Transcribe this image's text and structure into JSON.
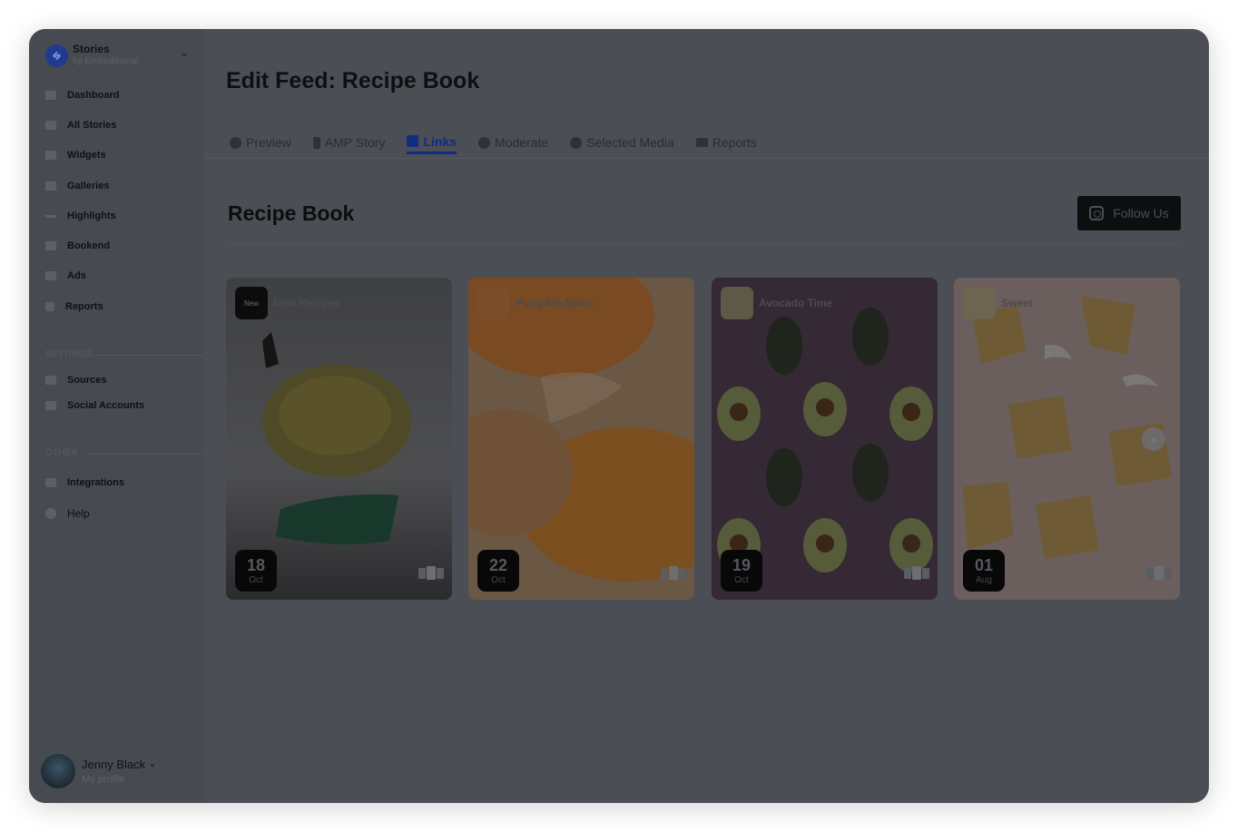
{
  "brand": {
    "name": "Stories",
    "sub": "by EmbedSocial",
    "logo_icon": "embedsocial-logo-icon"
  },
  "sidebar": {
    "items": [
      {
        "label": "Dashboard",
        "icon": "chart-icon"
      },
      {
        "label": "All Stories",
        "icon": "stories-icon"
      },
      {
        "label": "Widgets",
        "icon": "widgets-icon"
      },
      {
        "label": "Galleries",
        "icon": "galleries-icon"
      },
      {
        "label": "Highlights",
        "icon": "dots-icon"
      },
      {
        "label": "Bookend",
        "icon": "book-icon"
      },
      {
        "label": "Ads",
        "icon": "ads-icon"
      },
      {
        "label": "Reports",
        "icon": "file-icon"
      }
    ],
    "settings_title": "SETTINGS",
    "settings_items": [
      {
        "label": "Sources",
        "icon": "database-icon"
      },
      {
        "label": "Social Accounts",
        "icon": "users-icon"
      }
    ],
    "other_title": "OTHER",
    "other_items": [
      {
        "label": "Integrations",
        "icon": "puzzle-icon"
      },
      {
        "label": "Help",
        "icon": "question-icon"
      }
    ]
  },
  "profile": {
    "name": "Jenny Black",
    "sub": "My profile"
  },
  "page": {
    "title_prefix": "Edit Feed:",
    "title_name": "Recipe Book"
  },
  "tabs": [
    {
      "label": "Preview",
      "icon": "eye-icon",
      "active": false
    },
    {
      "label": "AMP Story",
      "icon": "bolt-icon",
      "active": false
    },
    {
      "label": "Links",
      "icon": "edit-icon",
      "active": true
    },
    {
      "label": "Moderate",
      "icon": "gear-icon",
      "active": false
    },
    {
      "label": "Selected Media",
      "icon": "check-circle-icon",
      "active": false
    },
    {
      "label": "Reports",
      "icon": "chart-line-icon",
      "active": false
    }
  ],
  "feed": {
    "title": "Recipe Book",
    "follow_label": "Follow Us",
    "follow_icon": "instagram-icon"
  },
  "cards": [
    {
      "name": "New Recipes",
      "thumb_text": "New",
      "day": "18",
      "month": "Oct",
      "bg": "#494a4d"
    },
    {
      "name": "Pumpkin Spice",
      "thumb_text": "",
      "day": "22",
      "month": "Oct",
      "bg": "#6e5a45"
    },
    {
      "name": "Avocado Time",
      "thumb_text": "",
      "day": "19",
      "month": "Oct",
      "bg": "#352c36"
    },
    {
      "name": "Sweet",
      "thumb_text": "",
      "day": "01",
      "month": "Aug",
      "bg": "#6a5f58"
    }
  ],
  "colors": {
    "accent": "#102d80",
    "overlay": "#4b4e54"
  }
}
